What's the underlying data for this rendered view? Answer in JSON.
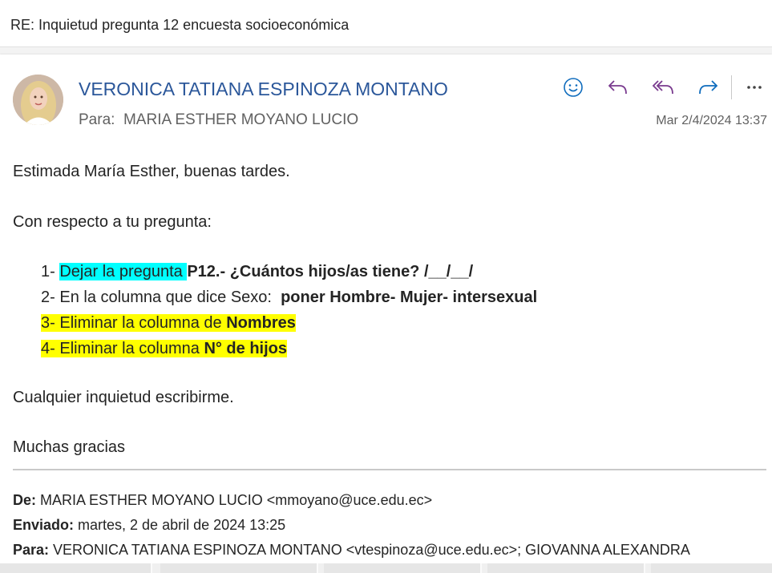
{
  "subject": "RE: Inquietud pregunta 12 encuesta socioeconómica",
  "header": {
    "sender": "VERONICA TATIANA ESPINOZA MONTANO",
    "to_label": "Para:",
    "to_value": "MARIA ESTHER MOYANO LUCIO",
    "date": "Mar 2/4/2024 13:37",
    "actions": [
      "smiley-icon",
      "reply-icon",
      "reply-all-icon",
      "forward-icon",
      "more-icon"
    ]
  },
  "body": {
    "greeting": "Estimada María Esther, buenas tardes.",
    "intro": "Con respecto a tu pregunta:",
    "items": [
      {
        "num": "1-",
        "hl": "Dejar la pregunta ",
        "bold": "P12.- ¿Cuántos hijos/as tiene? /__/__/"
      },
      {
        "num": "2-",
        "text": "En la columna que dice Sexo:  ",
        "bold": "poner Hombre- Mujer- intersexual"
      },
      {
        "num": "3-",
        "hl": "Eliminar la columna de ",
        "bold": "Nombres"
      },
      {
        "num": "4-",
        "hl": "Eliminar la columna ",
        "bold": "N° de hijos"
      }
    ],
    "closing1": "Cualquier inquietud escribirme.",
    "closing2": "Muchas gracias"
  },
  "quoted": {
    "from_label": "De:",
    "from_value": " MARIA ESTHER MOYANO LUCIO <mmoyano@uce.edu.ec>",
    "sent_label": "Enviado:",
    "sent_value": " martes, 2 de abril de 2024 13:25",
    "to_label": "Para:",
    "to_value": " VERONICA TATIANA ESPINOZA MONTANO <vtespinoza@uce.edu.ec>; GIOVANNA ALEXANDRA"
  },
  "colors": {
    "sender": "#2b579a",
    "accent": "#0f6cbd",
    "reply_all": "#7a3b8f",
    "cyan": "#00ffff",
    "yellow": "#ffff00"
  }
}
